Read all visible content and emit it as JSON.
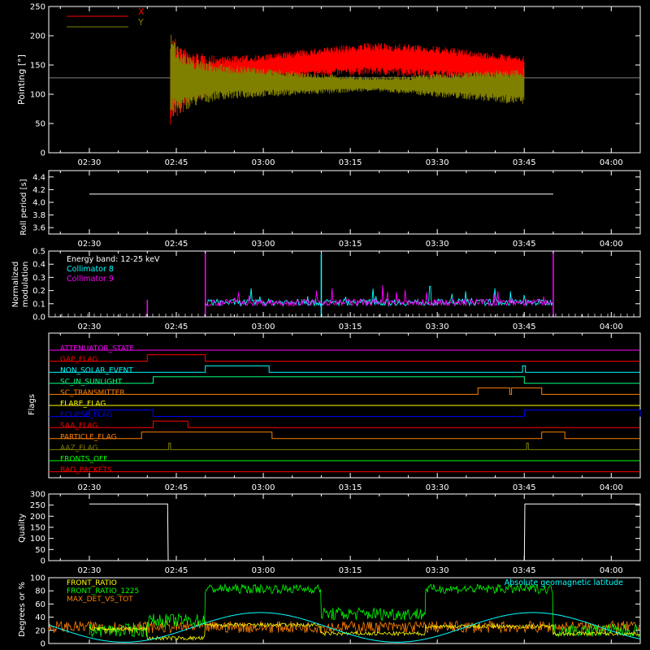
{
  "chart_data": [
    {
      "type": "line",
      "id": "pointing",
      "ylabel": "Pointing [°]",
      "ylim": [
        0,
        250
      ],
      "yticks": [
        "0",
        "50",
        "100",
        "150",
        "200",
        "250"
      ],
      "xticks": [
        "02:30",
        "02:45",
        "03:00",
        "03:15",
        "03:30",
        "03:45",
        "04:00"
      ],
      "series": [
        {
          "name": "X",
          "color": "#ff0000",
          "envelope": {
            "t": [
              "02:44",
              "02:47",
              "02:52",
              "03:00",
              "03:10",
              "03:18",
              "03:25",
              "03:32",
              "03:40",
              "03:45"
            ],
            "min": [
              48,
              75,
              110,
              122,
              130,
              133,
              131,
              127,
              123,
              122
            ],
            "max": [
              205,
              175,
              165,
              168,
              180,
              188,
              186,
              180,
              170,
              165
            ]
          }
        },
        {
          "name": "Y",
          "color": "#808000",
          "envelope": {
            "t": [
              "02:44",
              "02:47",
              "02:52",
              "03:00",
              "03:10",
              "03:18",
              "03:25",
              "03:32",
              "03:40",
              "03:45"
            ],
            "min": [
              55,
              75,
              90,
              95,
              100,
              105,
              100,
              93,
              87,
              80
            ],
            "max": [
              205,
              165,
              152,
              145,
              135,
              130,
              132,
              137,
              142,
              145
            ]
          }
        }
      ],
      "baseline": 128
    },
    {
      "type": "line",
      "id": "roll-period",
      "ylabel": "Roll period [s]",
      "ylim": [
        3.5,
        4.5
      ],
      "yticks": [
        "3.6",
        "3.8",
        "4.0",
        "4.2",
        "4.4"
      ],
      "xticks": [
        "02:30",
        "02:45",
        "03:00",
        "03:15",
        "03:30",
        "03:45",
        "04:00"
      ],
      "series": [
        {
          "name": "",
          "color": "#ffffff",
          "constant": 4.13,
          "x_range": [
            "02:30",
            "03:50"
          ]
        }
      ]
    },
    {
      "type": "line",
      "id": "modulation",
      "ylabel_lines": [
        "Normalized",
        "modulation"
      ],
      "ylim": [
        0,
        0.5
      ],
      "yticks": [
        "0.0",
        "0.1",
        "0.2",
        "0.3",
        "0.4",
        "0.5"
      ],
      "xticks": [
        "02:30",
        "02:45",
        "03:00",
        "03:15",
        "03:30",
        "03:45",
        "04:00"
      ],
      "legend_title": "Energy band: 12-25 keV",
      "series": [
        {
          "name": "Collimator 8",
          "color": "#00ffff",
          "spikes": [
            [
              "03:10",
              0.48
            ]
          ]
        },
        {
          "name": "Collimator 9",
          "color": "#ff00ff",
          "spikes": [
            [
              "02:40",
              0.13
            ],
            [
              "02:50",
              0.5
            ],
            [
              "03:50",
              0.5
            ]
          ]
        }
      ],
      "active_range": [
        "02:50",
        "03:50"
      ],
      "typical_level": 0.11
    },
    {
      "type": "line",
      "id": "flags",
      "ylabel": "Flags",
      "xticks": [
        "02:30",
        "02:45",
        "03:00",
        "03:15",
        "03:30",
        "03:45",
        "04:00"
      ],
      "flags": [
        {
          "name": "ATTENUATOR_STATE",
          "color": "#ff00ff",
          "on": []
        },
        {
          "name": "GAP_FLAG",
          "color": "#ff0000",
          "on": [
            [
              "02:40",
              "02:50"
            ]
          ]
        },
        {
          "name": "NON_SOLAR_EVENT",
          "color": "#00ffff",
          "on": [
            [
              "02:50",
              "03:01"
            ],
            [
              "03:44.7",
              "03:45.2"
            ]
          ]
        },
        {
          "name": "SC_IN_SUNLIGHT",
          "color": "#00ff80",
          "on": [
            [
              "02:41",
              "03:45"
            ]
          ]
        },
        {
          "name": "SC_TRANSMITTER",
          "color": "#ff8000",
          "on": [
            [
              "03:37",
              "03:42.5"
            ],
            [
              "03:42.8",
              "03:48"
            ]
          ]
        },
        {
          "name": "FLARE_FLAG",
          "color": "#ffff00",
          "on": []
        },
        {
          "name": "ECLIPSE_FLAG",
          "color": "#0000ff",
          "on": [
            [
              "02:30",
              "02:41"
            ],
            [
              "03:45",
              "04:05"
            ]
          ]
        },
        {
          "name": "SAA_FLAG",
          "color": "#ff0000",
          "on": [
            [
              "02:41",
              "02:47"
            ]
          ]
        },
        {
          "name": "PARTICLE_FLAG",
          "color": "#ff8000",
          "on": [
            [
              "02:39",
              "03:01.5"
            ],
            [
              "03:48",
              "03:52"
            ]
          ]
        },
        {
          "name": "AAZ_FLAG",
          "color": "#808000",
          "on": [
            [
              "02:43.7",
              "02:44"
            ],
            [
              "03:45.4",
              "03:45.7"
            ]
          ]
        },
        {
          "name": "FRONTS_OFF",
          "color": "#00ff00",
          "on": []
        },
        {
          "name": "BAD_PACKETS",
          "color": "#ff0000",
          "on": []
        }
      ]
    },
    {
      "type": "line",
      "id": "quality",
      "ylabel": "Quality",
      "ylim": [
        0,
        300
      ],
      "yticks": [
        "0",
        "50",
        "100",
        "150",
        "200",
        "250",
        "300"
      ],
      "xticks": [
        "02:30",
        "02:45",
        "03:00",
        "03:15",
        "03:30",
        "03:45",
        "04:00"
      ],
      "series": [
        {
          "name": "",
          "color": "#ffffff",
          "points": [
            [
              "02:30",
              255
            ],
            [
              "02:43.5",
              255
            ],
            [
              "02:43.6",
              0
            ],
            [
              "03:45",
              0
            ],
            [
              "03:45.1",
              255
            ],
            [
              "04:05",
              255
            ]
          ]
        }
      ]
    },
    {
      "type": "line",
      "id": "ratios",
      "ylabel": "Degrees or %",
      "ylim": [
        0,
        100
      ],
      "yticks": [
        "0",
        "20",
        "40",
        "60",
        "80",
        "100"
      ],
      "xticks": [
        "02:30",
        "02:45",
        "03:00",
        "03:15",
        "03:30",
        "03:45",
        "04:00"
      ],
      "series": [
        {
          "name": "FRONT_RATIO",
          "color": "#ffff00",
          "segments": [
            [
              "02:30",
              "02:40",
              22
            ],
            [
              "02:40",
              "02:50",
              8
            ],
            [
              "02:50",
              "03:10",
              28
            ],
            [
              "03:10",
              "03:28",
              15
            ],
            [
              "03:28",
              "03:50",
              26
            ],
            [
              "03:50",
              "04:05",
              15
            ]
          ]
        },
        {
          "name": "FRONT_RATIO_1225",
          "color": "#00ff00",
          "segments": [
            [
              "02:30",
              "02:40",
              20
            ],
            [
              "02:40",
              "02:50",
              35
            ],
            [
              "02:50",
              "03:10",
              83
            ],
            [
              "03:10",
              "03:28",
              45
            ],
            [
              "03:28",
              "03:50",
              83
            ],
            [
              "03:50",
              "04:05",
              20
            ]
          ]
        },
        {
          "name": "MAX_DET_VS_TOT",
          "color": "#ff8000",
          "level": 25
        },
        {
          "name": "Absolute geomagnetic latitude",
          "color": "#00ffff",
          "sine": {
            "min": 2,
            "max": 47,
            "period_min": 47,
            "phase_time": "02:36"
          }
        }
      ]
    }
  ]
}
